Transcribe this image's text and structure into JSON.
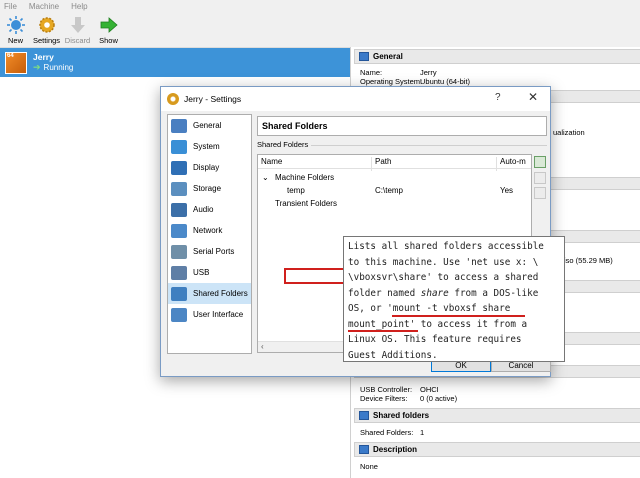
{
  "menubar": {
    "items": [
      "File",
      "Machine",
      "Help"
    ]
  },
  "toolbar": {
    "buttons": [
      {
        "label": "New",
        "icon": "new-sun-icon"
      },
      {
        "label": "Settings",
        "icon": "settings-gear-icon"
      },
      {
        "label": "Discard",
        "icon": "discard-arrow-icon"
      },
      {
        "label": "Show",
        "icon": "show-arrow-icon"
      }
    ]
  },
  "vm": {
    "name": "Jerry",
    "state": "Running"
  },
  "details": {
    "general": {
      "title": "General",
      "name_label": "Name:",
      "name_value": "Jerry",
      "os_label": "Operating System:",
      "os_value": "Ubuntu (64-bit)"
    },
    "partial_virtualization": "ualization",
    "partial_disk": "iso (55.29 MB)",
    "usb": {
      "controller_label": "USB Controller:",
      "controller_value": "OHCI",
      "filters_label": "Device Filters:",
      "filters_value": "0 (0 active)"
    },
    "shared": {
      "title": "Shared folders",
      "label": "Shared Folders:",
      "value": "1"
    },
    "description": {
      "title": "Description",
      "value": "None"
    }
  },
  "dialog": {
    "title": "Jerry - Settings",
    "help": "?",
    "close": "✕",
    "nav": [
      {
        "label": "General",
        "color": "#4a7fc1"
      },
      {
        "label": "System",
        "color": "#3a8fd6"
      },
      {
        "label": "Display",
        "color": "#2f6fb5"
      },
      {
        "label": "Storage",
        "color": "#5b8fbf"
      },
      {
        "label": "Audio",
        "color": "#3c6fa8"
      },
      {
        "label": "Network",
        "color": "#4b89c9"
      },
      {
        "label": "Serial Ports",
        "color": "#6f8fa8"
      },
      {
        "label": "USB",
        "color": "#5f7fa6"
      },
      {
        "label": "Shared Folders",
        "color": "#3f7fc0"
      },
      {
        "label": "User Interface",
        "color": "#4c86c4"
      }
    ],
    "selected_nav": "Shared Folders",
    "page_title": "Shared Folders",
    "group_label": "Shared Folders",
    "columns": {
      "name": "Name",
      "path": "Path",
      "auto": "Auto-m"
    },
    "machine_group": "Machine Folders",
    "folder": {
      "name": "temp",
      "path": "C:\\temp",
      "auto": "Yes"
    },
    "transient_group": "Transient Folders",
    "ok": "OK",
    "cancel": "Cancel"
  },
  "tooltip": {
    "line1": "Lists all shared folders accessible",
    "line2": "to this machine. Use 'net use x: \\",
    "line3": "\\vboxsvr\\share' to access a shared",
    "line4a": "folder named ",
    "line4b": "share",
    "line4c": " from a DOS-like",
    "line5": "OS, or 'mount -t vboxsf share",
    "line6": "mount_point' to access it from a",
    "line7": "Linux OS. This feature requires",
    "line8": "Guest Additions."
  },
  "colors": {
    "selection_blue": "#3d93d8",
    "highlight_red": "#d0201d",
    "nav_selected": "#cce4f7"
  }
}
